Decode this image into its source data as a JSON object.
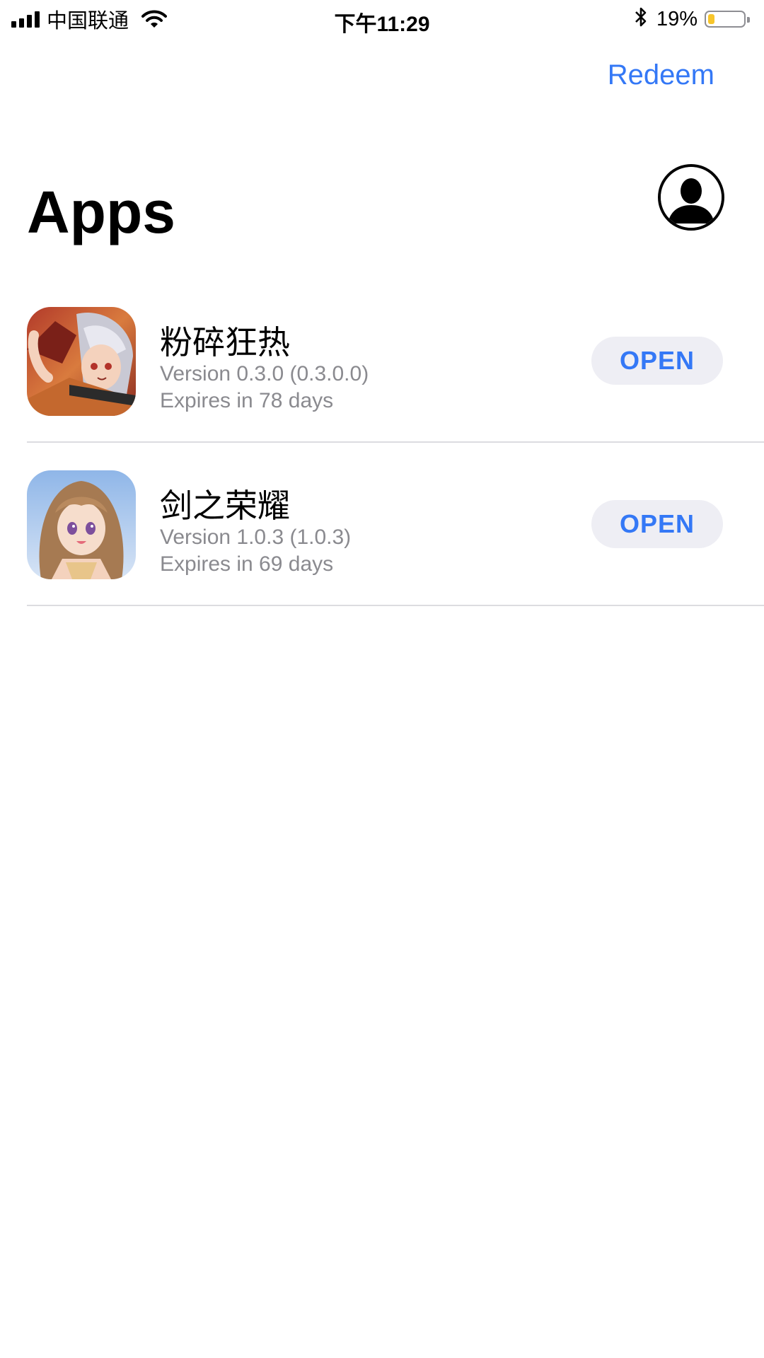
{
  "status_bar": {
    "carrier": "中国联通",
    "time": "下午11:29",
    "bluetooth": "bluetooth-icon",
    "battery_percent": "19%",
    "battery_level": 0.19,
    "battery_color": "#f7c52b"
  },
  "header": {
    "redeem_label": "Redeem",
    "title": "Apps",
    "account_icon": "account-icon"
  },
  "apps": [
    {
      "name": "粉碎狂热",
      "version": "Version 0.3.0 (0.3.0.0)",
      "expires": "Expires in 78 days",
      "button": "OPEN"
    },
    {
      "name": "剑之荣耀",
      "version": "Version 1.0.3 (1.0.3)",
      "expires": "Expires in 69 days",
      "button": "OPEN"
    }
  ],
  "colors": {
    "accent": "#3478f6",
    "button_bg": "#eeeef4",
    "secondary_text": "#8a8a8f"
  }
}
